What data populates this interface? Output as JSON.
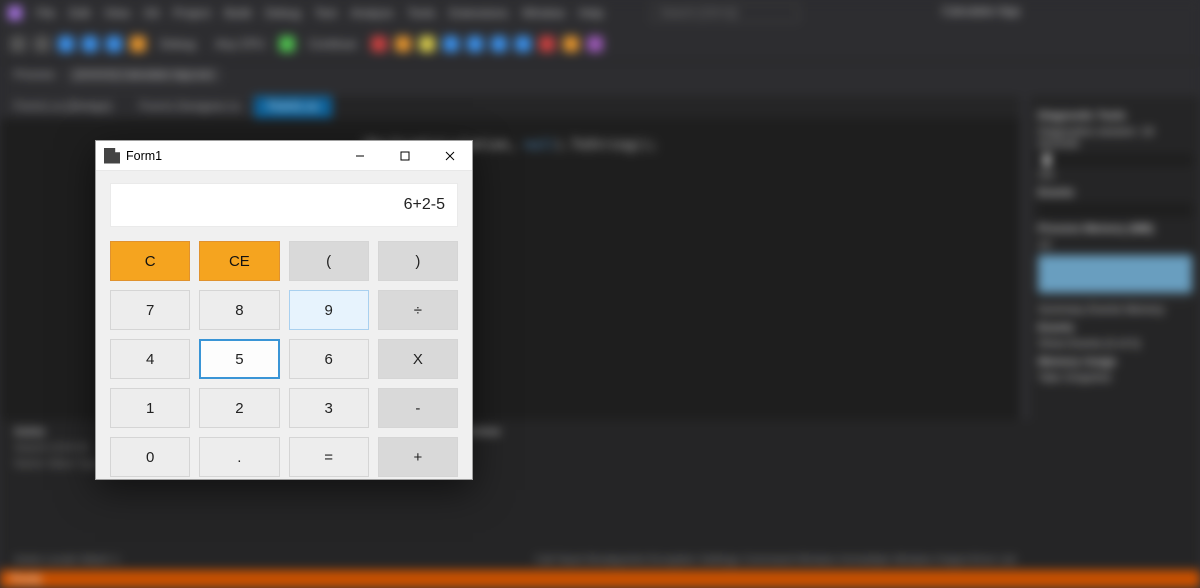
{
  "ide": {
    "title": "Calculator App",
    "menu": [
      "File",
      "Edit",
      "View",
      "Git",
      "Project",
      "Build",
      "Debug",
      "Test",
      "Analyze",
      "Tools",
      "Extensions",
      "Window",
      "Help"
    ],
    "search_placeholder": "Search (Ctrl+Q)",
    "tabs": [
      {
        "label": "Form1.cs [Design]"
      },
      {
        "label": "Form1.Designer.cs"
      },
      {
        "label": "Form1.cs"
      }
    ],
    "right": {
      "panel_title": "Diagnostic Tools",
      "session": "Diagnostics session: 18 seconds",
      "session_val": "10s",
      "events_label": "Events",
      "proc_mem": "Process Memory (MB)",
      "proc_val": "13",
      "tabs": "Summary  Events  Memory",
      "events2": "Events",
      "show_events": "Show Events (0 of 0)",
      "mem_usage": "Memory Usage",
      "snapshot": "Take Snapshot"
    },
    "bottom": {
      "autos": "Autos",
      "search": "Search (Ctrl+E)",
      "cols": "Name        Value        Type",
      "imm": "Immediate Window",
      "tabs_left": "Autos  Locals  Watch 1",
      "tabs_right": "Call Stack  Breakpoints  Exception Settings  Command Window  Immediate Window  Output  Error List"
    },
    "status": {
      "ready": "Ready"
    }
  },
  "calc": {
    "window_title": "Form1",
    "display": "6+2-5",
    "buttons": [
      {
        "k": "C",
        "cls": "orange",
        "name": "clear-button"
      },
      {
        "k": "CE",
        "cls": "orange",
        "name": "clear-entry-button"
      },
      {
        "k": "(",
        "cls": "op",
        "name": "open-paren-button"
      },
      {
        "k": ")",
        "cls": "op",
        "name": "close-paren-button"
      },
      {
        "k": "7",
        "cls": "num",
        "name": "digit-7-button"
      },
      {
        "k": "8",
        "cls": "num",
        "name": "digit-8-button"
      },
      {
        "k": "9",
        "cls": "num sel9",
        "name": "digit-9-button"
      },
      {
        "k": "÷",
        "cls": "op",
        "name": "divide-button"
      },
      {
        "k": "4",
        "cls": "num",
        "name": "digit-4-button"
      },
      {
        "k": "5",
        "cls": "num sel5",
        "name": "digit-5-button"
      },
      {
        "k": "6",
        "cls": "num",
        "name": "digit-6-button"
      },
      {
        "k": "X",
        "cls": "op",
        "name": "multiply-button"
      },
      {
        "k": "1",
        "cls": "num",
        "name": "digit-1-button"
      },
      {
        "k": "2",
        "cls": "num",
        "name": "digit-2-button"
      },
      {
        "k": "3",
        "cls": "num",
        "name": "digit-3-button"
      },
      {
        "k": "-",
        "cls": "op",
        "name": "subtract-button"
      },
      {
        "k": "0",
        "cls": "num",
        "name": "digit-0-button"
      },
      {
        "k": ".",
        "cls": "num",
        "name": "decimal-button"
      },
      {
        "k": "=",
        "cls": "num",
        "name": "equals-button"
      },
      {
        "k": "+",
        "cls": "op",
        "name": "add-button"
      }
    ]
  }
}
